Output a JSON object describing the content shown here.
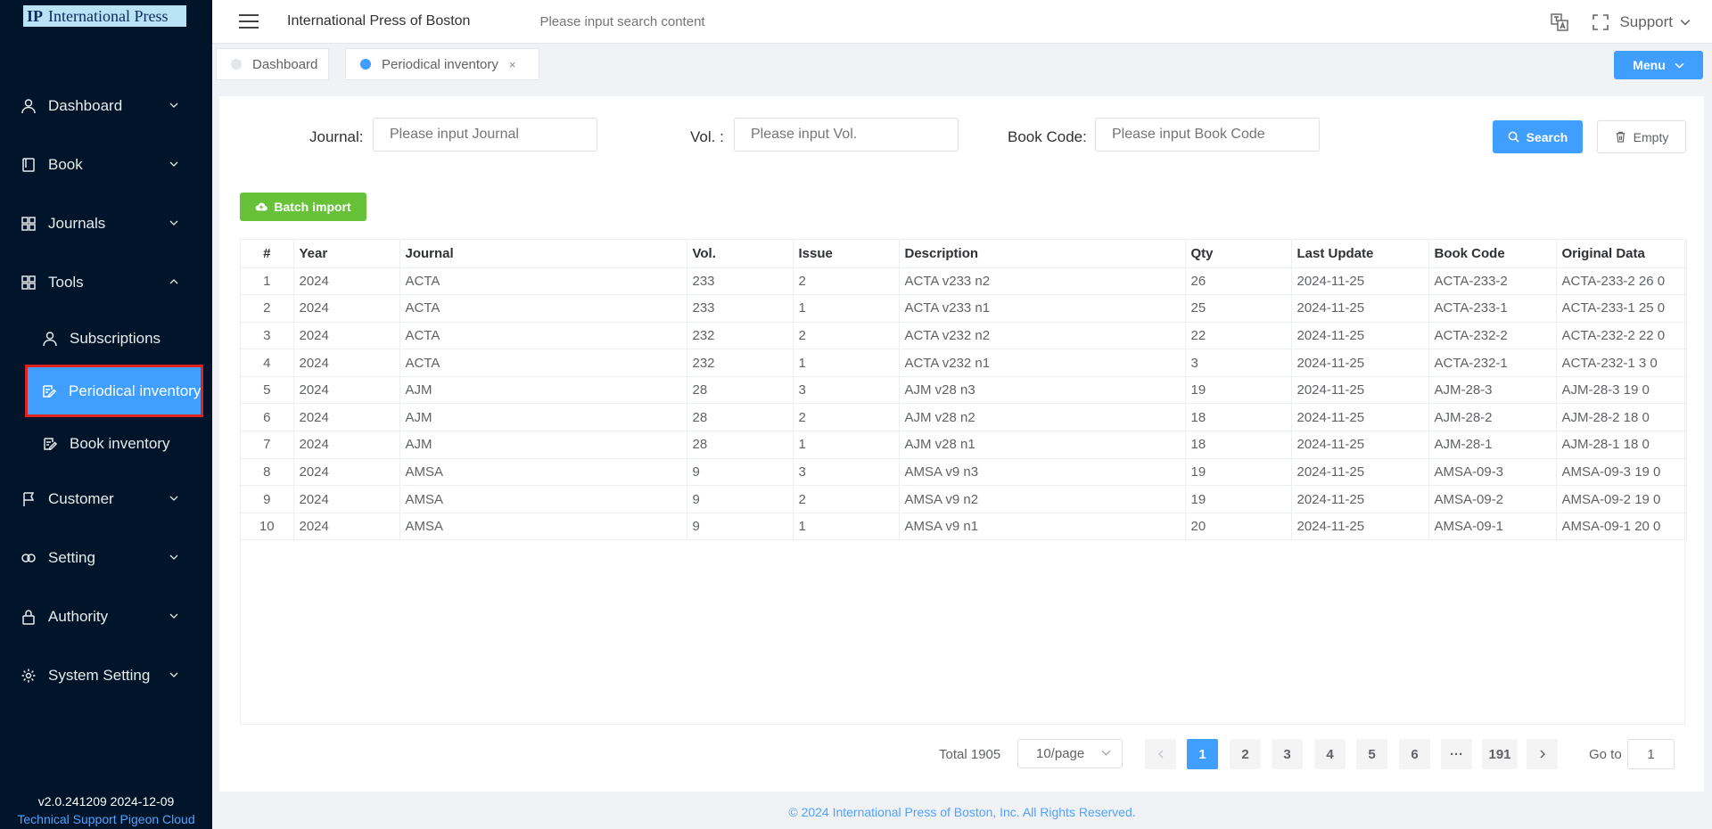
{
  "logo": {
    "mark": "IP",
    "text": "International Press"
  },
  "sidebar": {
    "items": [
      {
        "label": "Dashboard",
        "icon": "user-icon"
      },
      {
        "label": "Book",
        "icon": "book-icon"
      },
      {
        "label": "Journals",
        "icon": "grid-icon"
      },
      {
        "label": "Tools",
        "icon": "grid-icon"
      }
    ],
    "sub_items": [
      {
        "label": "Subscriptions",
        "icon": "user-icon"
      },
      {
        "label": "Periodical inventory",
        "icon": "edit-icon"
      },
      {
        "label": "Book inventory",
        "icon": "edit-icon"
      }
    ],
    "lower_items": [
      {
        "label": "Customer",
        "icon": "flag-icon"
      },
      {
        "label": "Setting",
        "icon": "link-icon"
      },
      {
        "label": "Authority",
        "icon": "lock-icon"
      },
      {
        "label": "System Setting",
        "icon": "gear-icon"
      }
    ],
    "version": "v2.0.241209 2024-12-09",
    "support": "Technical Support Pigeon Cloud"
  },
  "header": {
    "title": "International Press of Boston",
    "search_placeholder": "Please input search content",
    "support": "Support"
  },
  "tabs": [
    {
      "label": "Dashboard",
      "active": false
    },
    {
      "label": "Periodical inventory",
      "active": true
    }
  ],
  "tabs_close": "×",
  "menu_button": "Menu",
  "filters": {
    "journal_label": "Journal:",
    "journal_placeholder": "Please input Journal",
    "vol_label": "Vol. :",
    "vol_placeholder": "Please input Vol.",
    "code_label": "Book Code:",
    "code_placeholder": "Please input Book Code"
  },
  "buttons": {
    "search": "Search",
    "empty": "Empty",
    "batch_import": "Batch import"
  },
  "table": {
    "columns": [
      "#",
      "Year",
      "Journal",
      "Vol.",
      "Issue",
      "Description",
      "Qty",
      "Last Update",
      "Book Code",
      "Original Data"
    ],
    "rows": [
      [
        "1",
        "2024",
        "ACTA",
        "233",
        "2",
        "ACTA v233 n2",
        "26",
        "2024-11-25",
        "ACTA-233-2",
        "ACTA-233-2 26 0"
      ],
      [
        "2",
        "2024",
        "ACTA",
        "233",
        "1",
        "ACTA v233 n1",
        "25",
        "2024-11-25",
        "ACTA-233-1",
        "ACTA-233-1 25 0"
      ],
      [
        "3",
        "2024",
        "ACTA",
        "232",
        "2",
        "ACTA v232 n2",
        "22",
        "2024-11-25",
        "ACTA-232-2",
        "ACTA-232-2 22 0"
      ],
      [
        "4",
        "2024",
        "ACTA",
        "232",
        "1",
        "ACTA v232 n1",
        "3",
        "2024-11-25",
        "ACTA-232-1",
        "ACTA-232-1 3 0"
      ],
      [
        "5",
        "2024",
        "AJM",
        "28",
        "3",
        "AJM v28 n3",
        "19",
        "2024-11-25",
        "AJM-28-3",
        "AJM-28-3 19 0"
      ],
      [
        "6",
        "2024",
        "AJM",
        "28",
        "2",
        "AJM v28 n2",
        "18",
        "2024-11-25",
        "AJM-28-2",
        "AJM-28-2 18 0"
      ],
      [
        "7",
        "2024",
        "AJM",
        "28",
        "1",
        "AJM v28 n1",
        "18",
        "2024-11-25",
        "AJM-28-1",
        "AJM-28-1 18 0"
      ],
      [
        "8",
        "2024",
        "AMSA",
        "9",
        "3",
        "AMSA v9 n3",
        "19",
        "2024-11-25",
        "AMSA-09-3",
        "AMSA-09-3 19 0"
      ],
      [
        "9",
        "2024",
        "AMSA",
        "9",
        "2",
        "AMSA v9 n2",
        "19",
        "2024-11-25",
        "AMSA-09-2",
        "AMSA-09-2 19 0"
      ],
      [
        "10",
        "2024",
        "AMSA",
        "9",
        "1",
        "AMSA v9 n1",
        "20",
        "2024-11-25",
        "AMSA-09-1",
        "AMSA-09-1 20 0"
      ]
    ]
  },
  "pagination": {
    "total": "Total 1905",
    "page_size": "10/page",
    "pages": [
      "1",
      "2",
      "3",
      "4",
      "5",
      "6",
      "···",
      "191"
    ],
    "current": "1",
    "goto_label": "Go to",
    "goto_value": "1"
  },
  "footer": "© 2024 International Press of Boston, Inc. All Rights Reserved.",
  "colors": {
    "primary": "#409eff",
    "success": "#67c23a",
    "sidebar_bg": "#001529",
    "highlight": "#e0221f"
  }
}
